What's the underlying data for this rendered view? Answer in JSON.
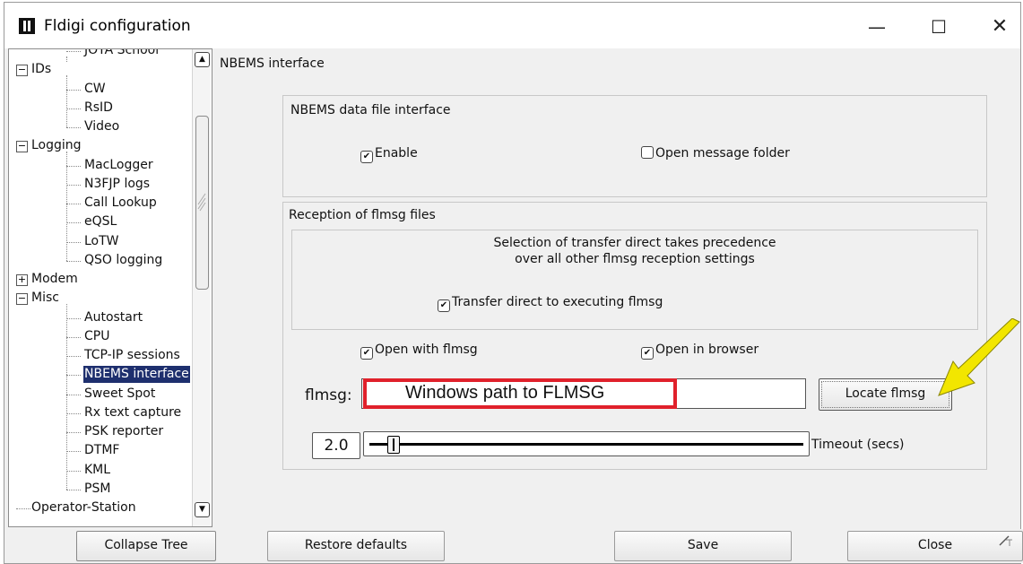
{
  "window": {
    "title": "Fldigi configuration",
    "minimize": "—",
    "maximize": "☐",
    "close": "✕"
  },
  "tree": {
    "items": [
      {
        "label": "JOTA School",
        "level": 1
      },
      {
        "label": "IDs",
        "level": 0,
        "expander": "−"
      },
      {
        "label": "CW",
        "level": 1
      },
      {
        "label": "RsID",
        "level": 1
      },
      {
        "label": "Video",
        "level": 1
      },
      {
        "label": "Logging",
        "level": 0,
        "expander": "−"
      },
      {
        "label": "MacLogger",
        "level": 1
      },
      {
        "label": "N3FJP logs",
        "level": 1
      },
      {
        "label": "Call Lookup",
        "level": 1
      },
      {
        "label": "eQSL",
        "level": 1
      },
      {
        "label": "LoTW",
        "level": 1
      },
      {
        "label": "QSO logging",
        "level": 1
      },
      {
        "label": "Modem",
        "level": 0,
        "expander": "+"
      },
      {
        "label": "Misc",
        "level": 0,
        "expander": "−"
      },
      {
        "label": "Autostart",
        "level": 1
      },
      {
        "label": "CPU",
        "level": 1
      },
      {
        "label": "TCP-IP sessions",
        "level": 1
      },
      {
        "label": "NBEMS interface",
        "level": 1,
        "selected": true
      },
      {
        "label": "Sweet Spot",
        "level": 1
      },
      {
        "label": "Rx text capture",
        "level": 1
      },
      {
        "label": "PSK reporter",
        "level": 1
      },
      {
        "label": "DTMF",
        "level": 1
      },
      {
        "label": "KML",
        "level": 1
      },
      {
        "label": "PSM",
        "level": 1
      },
      {
        "label": "Operator-Station",
        "level": 0
      }
    ]
  },
  "panel": {
    "title": "NBEMS interface",
    "data_file_group": {
      "label": "NBEMS data file interface",
      "enable": {
        "label": "Enable",
        "checked": true
      },
      "open_folder": {
        "label": "Open message folder",
        "checked": false
      }
    },
    "reception_group": {
      "label": "Reception of flmsg files",
      "note_line1": "Selection of transfer direct takes precedence",
      "note_line2": "over all other flmsg reception settings",
      "transfer_direct": {
        "label": "Transfer direct to executing flmsg",
        "checked": true
      },
      "open_with_flmsg": {
        "label": "Open with flmsg",
        "checked": true
      },
      "open_in_browser": {
        "label": "Open in browser",
        "checked": true
      },
      "flmsg_label": "flmsg:",
      "flmsg_path_annotation": "Windows path to FLMSG",
      "locate_button": "Locate flmsg",
      "timeout_value": "2.0",
      "timeout_label": "Timeout (secs)"
    }
  },
  "buttons": {
    "collapse_tree": "Collapse Tree",
    "restore_defaults": "Restore defaults",
    "save": "Save",
    "close": "Close"
  },
  "colors": {
    "annotation_box": "#e0212b",
    "annotation_arrow": "#f2e600",
    "selection": "#1e2f6e"
  }
}
